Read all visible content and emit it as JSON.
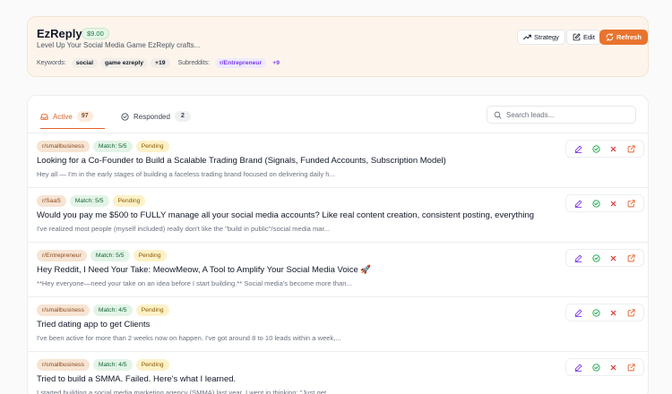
{
  "header": {
    "title": "EzReply",
    "price": "$9.00",
    "tagline": "Level Up Your Social Media Game EzReply crafts...",
    "keywords_label": "Keywords:",
    "keywords": [
      "social",
      "game ezreply"
    ],
    "keywords_more": "+19",
    "subreddits_label": "Subreddits:",
    "subreddits": [
      "r/Entrepreneur"
    ],
    "subreddits_more": "+9",
    "buttons": {
      "strategy": "Strategy",
      "edit": "Edit",
      "refresh": "Refresh"
    }
  },
  "tabs": {
    "active": {
      "label": "Active",
      "count": "97"
    },
    "responded": {
      "label": "Responded",
      "count": "2"
    }
  },
  "search": {
    "placeholder": "Search leads...",
    "value": ""
  },
  "leads": [
    {
      "subreddit": "r/smallbusiness",
      "match": "Match: 5/5",
      "status": "Pending",
      "title": "Looking for a Co-Founder to Build a Scalable Trading Brand (Signals, Funded Accounts, Subscription Model)",
      "excerpt": "Hey all — I'm in the early stages of building a faceless trading brand focused on delivering daily h..."
    },
    {
      "subreddit": "r/SaaS",
      "match": "Match: 5/5",
      "status": "Pending",
      "title": "Would you pay me $500 to FULLY manage all your social media accounts? Like real content creation, consistent posting, everything",
      "excerpt": "I've realized most people (myself included) really don't like the \"build in public\"/social media mar..."
    },
    {
      "subreddit": "r/Entrepreneur",
      "match": "Match: 5/5",
      "status": "Pending",
      "title": "Hey Reddit, I Need Your Take: MeowMeow, A Tool to Amplify Your Social Media Voice 🚀",
      "excerpt": "**Hey everyone—need your take on an idea before I start building.** Social media's become more than..."
    },
    {
      "subreddit": "r/smallbusiness",
      "match": "Match: 4/5",
      "status": "Pending",
      "title": "Tried dating app to get Clients",
      "excerpt": "I've been active for more than 2 weeks now on happen. I've got around 8 to 10 leads within a week,..."
    },
    {
      "subreddit": "r/smallbusiness",
      "match": "Match: 4/5",
      "status": "Pending",
      "title": "Tried to build a SMMA. Failed. Here's what I learned.",
      "excerpt": "I started building a social media marketing agency (SMMA) last year. I went in thinking: \"Just get..."
    }
  ],
  "colors": {
    "accent": "#e8742e",
    "success": "#16a34a",
    "danger": "#dc2626",
    "edit": "#7c3aed"
  },
  "icons": [
    "trend-icon",
    "edit-icon",
    "refresh-icon",
    "inbox-icon",
    "check-circle-icon",
    "search-icon",
    "pencil-icon",
    "check-icon",
    "close-icon",
    "external-link-icon"
  ]
}
